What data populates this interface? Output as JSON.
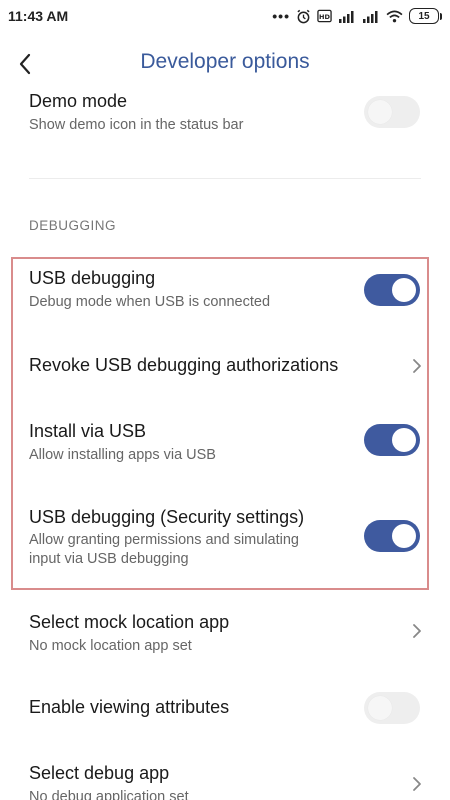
{
  "status_bar": {
    "time": "11:43 AM",
    "battery": "15",
    "icons": [
      "dots-icon",
      "alarm-icon",
      "hd-icon",
      "signal-icon",
      "signal-icon",
      "wifi-icon",
      "battery-icon"
    ]
  },
  "header": {
    "title": "Developer options",
    "back_icon": "chevron-left-icon"
  },
  "items": {
    "demo_mode": {
      "title": "Demo mode",
      "subtitle": "Show demo icon in the status bar",
      "toggle": "off"
    },
    "section_debugging": "DEBUGGING",
    "usb_debugging": {
      "title": "USB debugging",
      "subtitle": "Debug mode when USB is connected",
      "toggle": "on"
    },
    "revoke_usb": {
      "title": "Revoke USB debugging authorizations"
    },
    "install_via_usb": {
      "title": "Install via USB",
      "subtitle": "Allow installing apps via USB",
      "toggle": "on"
    },
    "usb_debugging_security": {
      "title": "USB debugging (Security settings)",
      "subtitle_line1": "Allow granting permissions and simulating",
      "subtitle_line2": "input via USB debugging",
      "toggle": "on"
    },
    "mock_location": {
      "title": "Select mock location app",
      "subtitle": "No mock location app set"
    },
    "view_attributes": {
      "title": "Enable viewing attributes",
      "toggle": "off"
    },
    "debug_app": {
      "title": "Select debug app",
      "subtitle": "No debug application set"
    }
  },
  "colors": {
    "accent": "#3f5a9f",
    "title": "#3a5a9b",
    "highlight_border": "#d98c8c",
    "toggle_off": "#eeeeee"
  }
}
